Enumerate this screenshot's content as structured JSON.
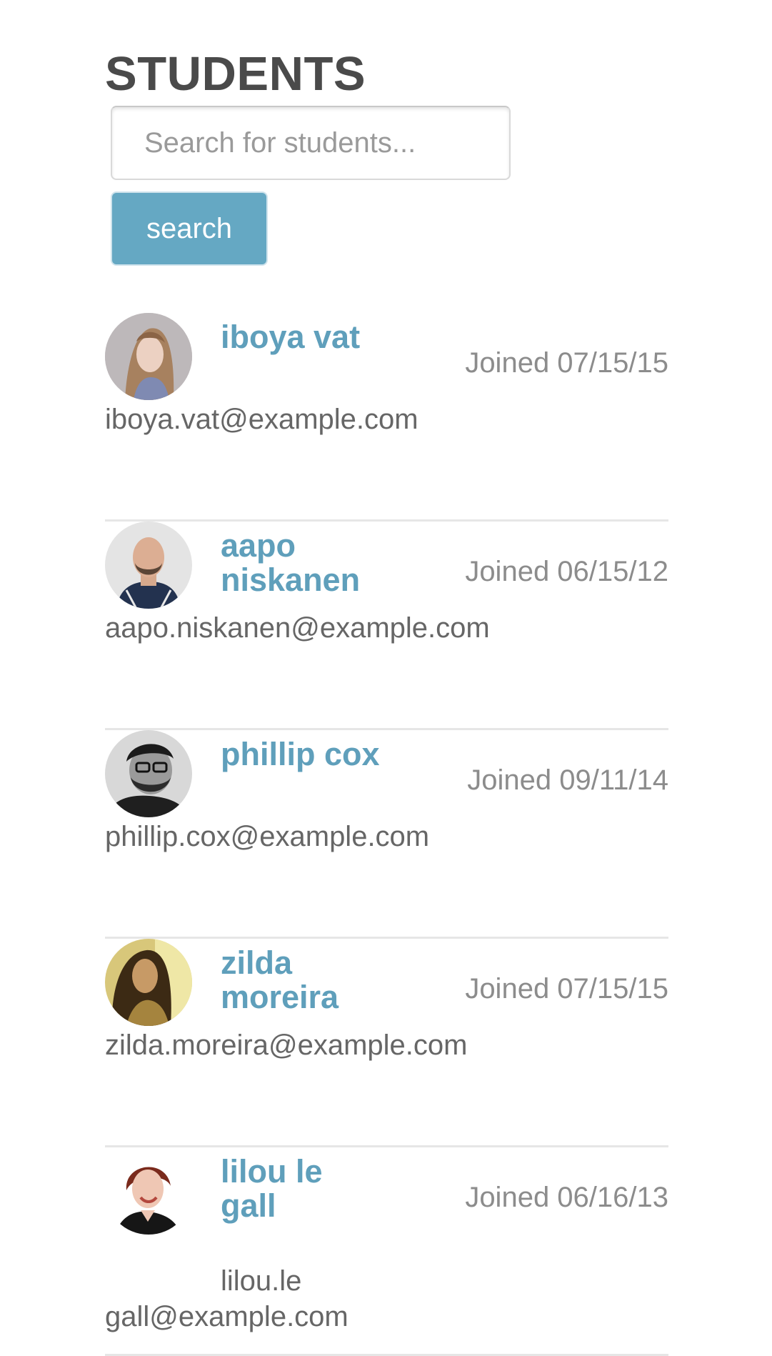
{
  "page": {
    "title": "STUDENTS"
  },
  "search": {
    "placeholder": "Search for students...",
    "value": "",
    "button_label": "search"
  },
  "colors": {
    "accent": "#65a8c3",
    "name_text": "#5f9fbb",
    "divider": "#e6e6e6"
  },
  "students": [
    {
      "name": "iboya vat",
      "joined": "Joined 07/15/15",
      "email": "iboya.vat@example.com",
      "avatar_icon": "avatar-photo"
    },
    {
      "name": "aapo niskanen",
      "joined": "Joined 06/15/12",
      "email": "aapo.niskanen@example.com",
      "avatar_icon": "avatar-photo"
    },
    {
      "name": "phillip cox",
      "joined": "Joined 09/11/14",
      "email": "phillip.cox@example.com",
      "avatar_icon": "avatar-photo"
    },
    {
      "name": "zilda moreira",
      "joined": "Joined 07/15/15",
      "email": "zilda.moreira@example.com",
      "avatar_icon": "avatar-photo"
    },
    {
      "name": "lilou le gall",
      "joined": "Joined 06/16/13",
      "email": "lilou.le gall@example.com",
      "avatar_icon": "avatar-photo"
    }
  ]
}
